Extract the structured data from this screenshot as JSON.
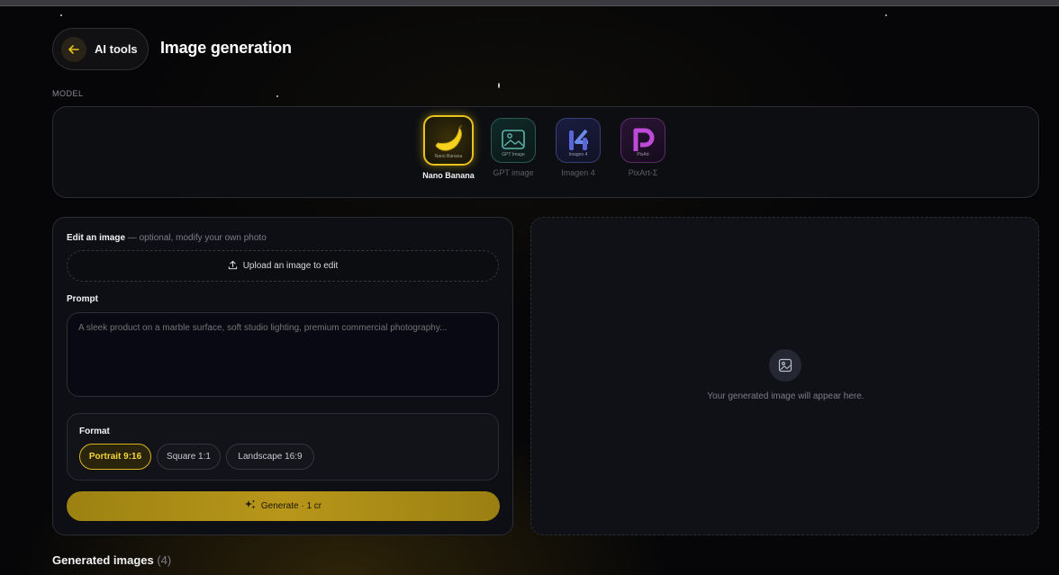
{
  "header": {
    "back_label": "AI tools",
    "page_title": "Image generation"
  },
  "model": {
    "caption": "MODEL",
    "items": [
      {
        "name": "Nano Banana",
        "tile_text": "Nano Banana",
        "active": true
      },
      {
        "name": "GPT image",
        "tile_text": "GPT Image",
        "active": false
      },
      {
        "name": "Imagen 4",
        "tile_text": "Imagen 4",
        "active": false
      },
      {
        "name": "PixArt-Σ",
        "tile_text": "PixArt",
        "active": false
      }
    ]
  },
  "edit": {
    "label": "Edit an image",
    "sublabel": " — optional, modify your own photo",
    "upload_label": "Upload an image to edit"
  },
  "prompt": {
    "label": "Prompt",
    "placeholder": "A sleek product on a marble surface, soft studio lighting, premium commercial photography..."
  },
  "format": {
    "label": "Format",
    "options": [
      "Portrait 9:16",
      "Square 1:1",
      "Landscape 16:9"
    ],
    "selected": "Portrait 9:16"
  },
  "generate": {
    "label": "Generate · 1 cr"
  },
  "preview": {
    "empty_text": "Your generated image will appear here."
  },
  "generated": {
    "title": "Generated images",
    "count": "(4)"
  },
  "colors": {
    "accent": "#e8c21d",
    "background": "#060608",
    "panel": "#0e0f14"
  }
}
